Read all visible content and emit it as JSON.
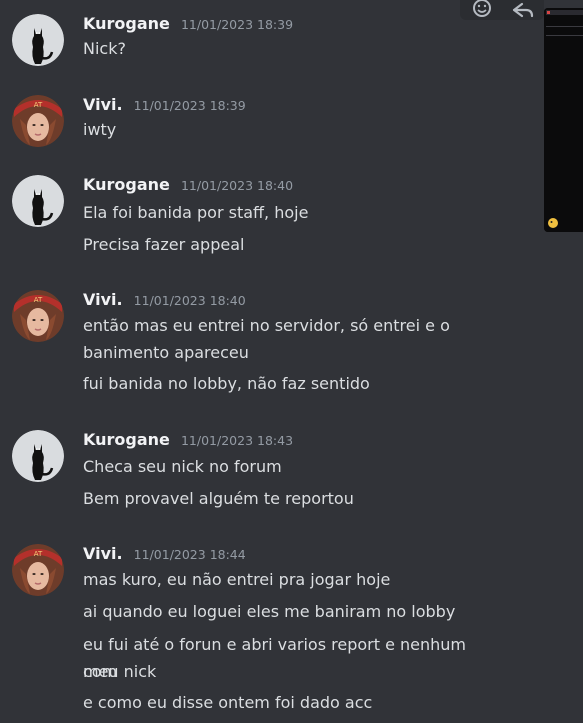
{
  "messages": [
    {
      "author": "Kurogane",
      "avatar": "cat-avatar",
      "timestamp": "11/01/2023 18:39",
      "lines": [
        "Nick?"
      ]
    },
    {
      "author": "Vivi.",
      "avatar": "girl-avatar",
      "timestamp": "11/01/2023 18:39",
      "lines": [
        "iwty"
      ]
    },
    {
      "author": "Kurogane",
      "avatar": "cat-avatar",
      "timestamp": "11/01/2023 18:40",
      "lines": [
        "Ela foi banida por staff, hoje",
        "Precisa fazer appeal"
      ]
    },
    {
      "author": "Vivi.",
      "avatar": "girl-avatar",
      "timestamp": "11/01/2023 18:40",
      "lines": [
        "então mas eu entrei no servidor, só entrei e o",
        "banimento apareceu",
        "fui banida no lobby, não faz sentido"
      ]
    },
    {
      "author": "Kurogane",
      "avatar": "cat-avatar",
      "timestamp": "11/01/2023 18:43",
      "lines": [
        "Checa seu nick no forum",
        "Bem provavel alguém te reportou"
      ]
    },
    {
      "author": "Vivi.",
      "avatar": "girl-avatar",
      "timestamp": "11/01/2023 18:44",
      "lines": [
        "mas kuro, eu não entrei pra jogar hoje",
        "ai quando eu loguei eles me baniram no lobby",
        "eu fui até o forun e abri varios report e nenhum com",
        "meu nick",
        "e como eu disse ontem foi dado acc"
      ]
    }
  ],
  "toolbar": {
    "icons": [
      "add-reaction-icon",
      "reply-icon"
    ]
  },
  "colors": {
    "background": "#313338",
    "author": "#f2f3f5",
    "timestamp": "#949ba4",
    "text": "#dbdee1"
  }
}
